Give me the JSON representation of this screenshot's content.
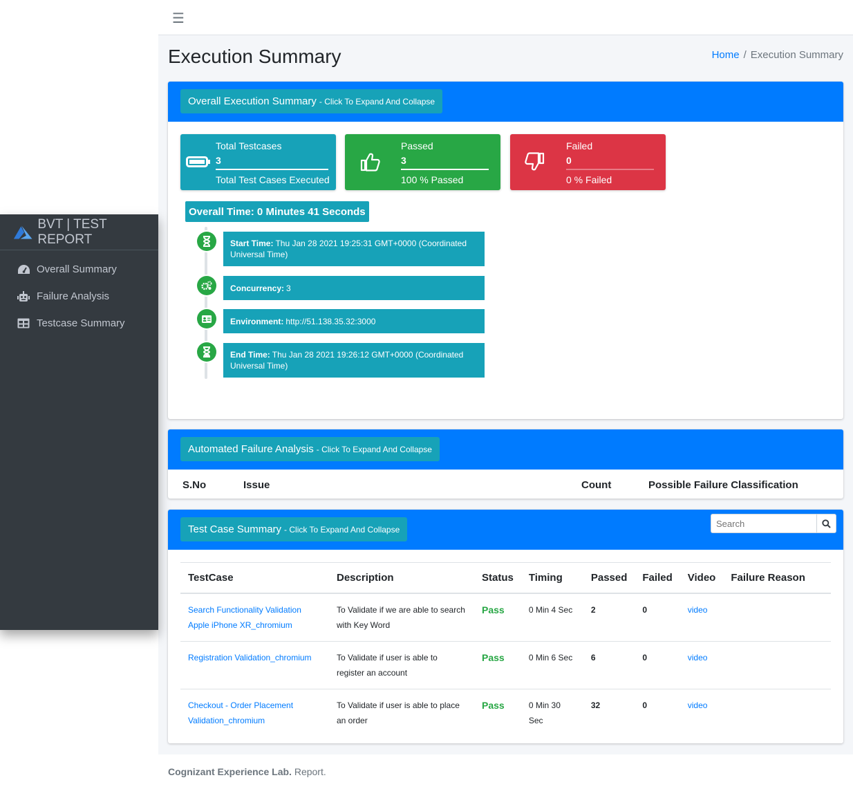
{
  "topbar": {
    "menu_icon": "bars-icon"
  },
  "page": {
    "title": "Execution Summary",
    "breadcrumb": {
      "home": "Home",
      "separator": "/",
      "current": "Execution Summary"
    }
  },
  "sidebar": {
    "brand": "BVT | TEST REPORT",
    "items": [
      {
        "label": "Overall Summary",
        "icon": "tachometer-icon"
      },
      {
        "label": "Failure Analysis",
        "icon": "robot-icon"
      },
      {
        "label": "Testcase Summary",
        "icon": "table-icon"
      }
    ]
  },
  "overall": {
    "header": "Overall Execution Summary",
    "header_hint": "- Click To Expand And Collapse",
    "total": {
      "title": "Total Testcases",
      "value": "3",
      "desc": "Total Test Cases Executed",
      "progress": 1.0
    },
    "passed": {
      "title": "Passed",
      "value": "3",
      "desc": "100 % Passed",
      "progress": 1.0
    },
    "failed": {
      "title": "Failed",
      "value": "0",
      "desc": "0 % Failed",
      "progress": 0.0
    },
    "overall_time": "Overall Time: 0 Minutes 41 Seconds",
    "timeline": [
      {
        "label": "Start Time:",
        "value": "Thu Jan 28 2021 19:25:31 GMT+0000 (Coordinated Universal Time)",
        "icon": "hourglass-start-icon"
      },
      {
        "label": "Concurrency:",
        "value": "3",
        "icon": "cogs-icon"
      },
      {
        "label": "Environment:",
        "value": "http://51.138.35.32:3000",
        "icon": "id-card-icon"
      },
      {
        "label": "End Time:",
        "value": "Thu Jan 28 2021 19:26:12 GMT+0000 (Coordinated Universal Time)",
        "icon": "hourglass-end-icon"
      }
    ]
  },
  "failure_analysis": {
    "header": "Automated Failure Analysis",
    "header_hint": "- Click To Expand And Collapse",
    "columns": [
      "S.No",
      "Issue",
      "Count",
      "Possible Failure Classification"
    ]
  },
  "testcase_summary": {
    "header": "Test Case Summary",
    "header_hint": "- Click To Expand And Collapse",
    "search_placeholder": "Search",
    "columns": [
      "TestCase",
      "Description",
      "Status",
      "Timing",
      "Passed",
      "Failed",
      "Video",
      "Failure Reason"
    ],
    "rows": [
      {
        "testcase": "Search Functionality Validation Apple iPhone XR_chromium",
        "description": "To Validate if we are able to search with Key Word",
        "status": "Pass",
        "timing": "0 Min 4 Sec",
        "passed": "2",
        "failed": "0",
        "video": "video",
        "failure_reason": ""
      },
      {
        "testcase": "Registration Validation_chromium",
        "description": "To Validate if user is able to register an account",
        "status": "Pass",
        "timing": "0 Min 6 Sec",
        "passed": "6",
        "failed": "0",
        "video": "video",
        "failure_reason": ""
      },
      {
        "testcase": "Checkout - Order Placement Validation_chromium",
        "description": "To Validate if user is able to place an order",
        "status": "Pass",
        "timing": "0 Min 30 Sec",
        "passed": "32",
        "failed": "0",
        "video": "video",
        "failure_reason": ""
      }
    ]
  },
  "footer": {
    "brand": "Cognizant Experience Lab.",
    "text": "Report."
  },
  "colors": {
    "primary": "#007bff",
    "info": "#17a2b8",
    "success": "#28a745",
    "danger": "#dc3545",
    "sidebar": "#343a40"
  }
}
